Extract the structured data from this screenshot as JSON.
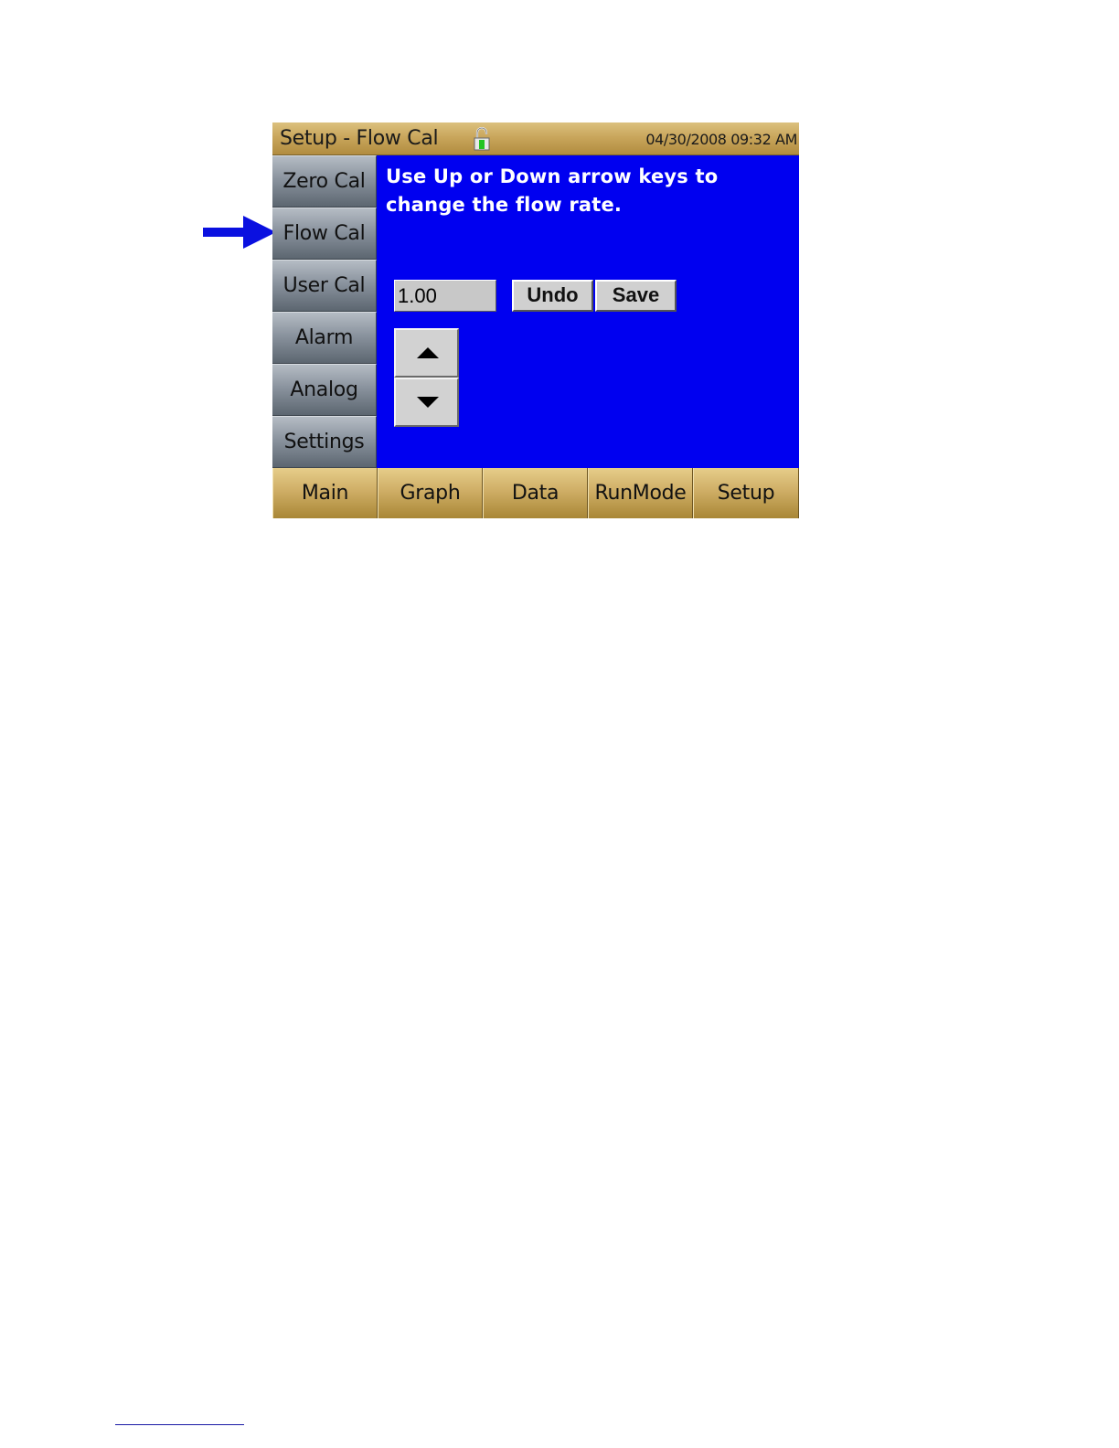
{
  "titlebar": {
    "title": "Setup - Flow Cal",
    "datetime": "04/30/2008 09:32 AM",
    "lock_icon": "unlocked-padlock-icon"
  },
  "sidebar": {
    "items": [
      {
        "label": "Zero Cal"
      },
      {
        "label": "Flow Cal"
      },
      {
        "label": "User Cal"
      },
      {
        "label": "Alarm"
      },
      {
        "label": "Analog"
      },
      {
        "label": "Settings"
      }
    ]
  },
  "content": {
    "instructions": "Use Up or Down arrow keys to change the flow rate.",
    "flow_value": "1.00",
    "undo_label": "Undo",
    "save_label": "Save",
    "up_icon": "arrow-up-icon",
    "down_icon": "arrow-down-icon"
  },
  "tabs": [
    {
      "label": "Main"
    },
    {
      "label": "Graph"
    },
    {
      "label": "Data"
    },
    {
      "label": "RunMode"
    },
    {
      "label": "Setup"
    }
  ],
  "colors": {
    "screen_background": "#0000f0",
    "pointer_arrow": "#0a10e0",
    "title_gold": "#c9a65c",
    "menu_gray": "#8a939e"
  }
}
